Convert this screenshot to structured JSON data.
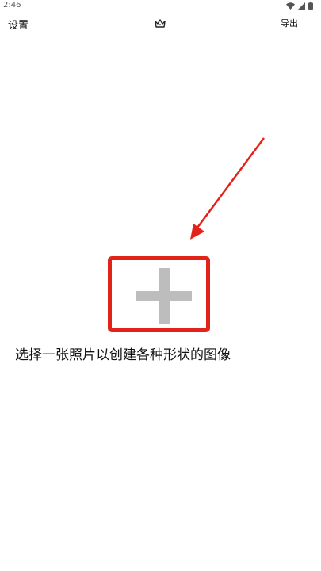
{
  "status_bar": {
    "time": "2:46",
    "icons": [
      "wifi-icon",
      "signal-icon",
      "battery-icon"
    ]
  },
  "app_bar": {
    "settings_label": "设置",
    "premium_icon": "crown-icon",
    "export_label": "导出"
  },
  "main": {
    "add_icon": "plus-icon",
    "hint": "选择一张照片以创建各种形状的图像"
  },
  "colors": {
    "highlight": "#e2231a",
    "plus": "#bdbdbd",
    "background": "#ffffff"
  }
}
